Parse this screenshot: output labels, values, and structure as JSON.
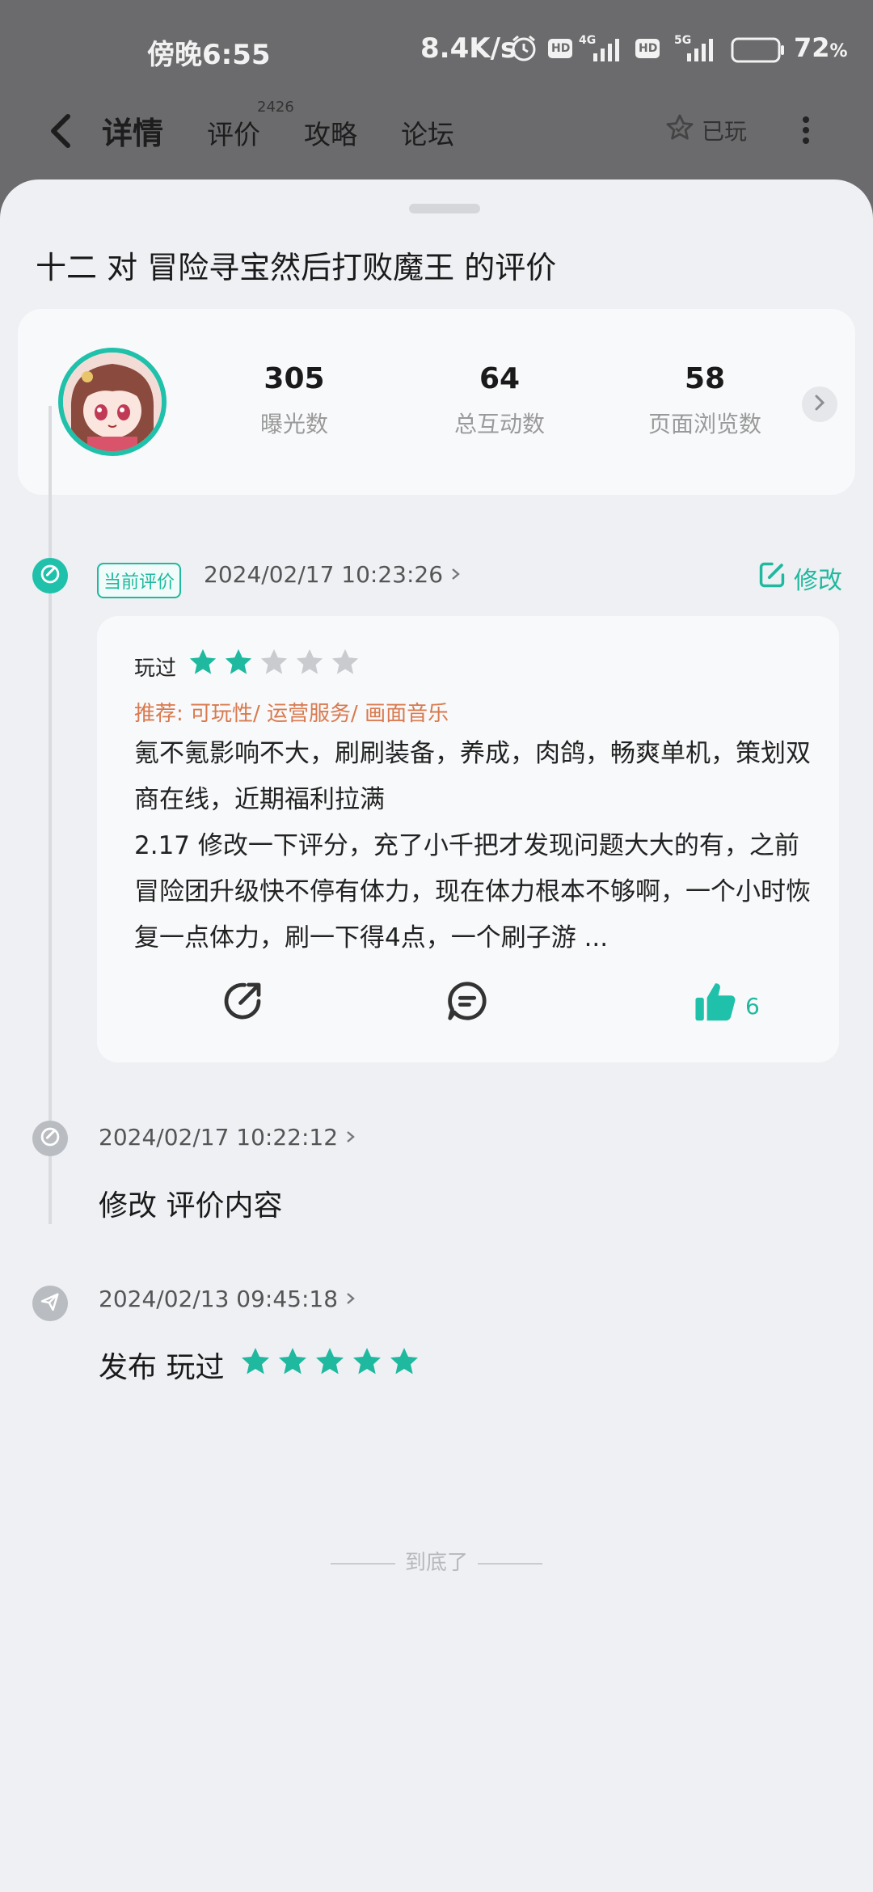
{
  "status_bar": {
    "time": "傍晚6:55",
    "net_speed": "8.4K/s",
    "battery": "72",
    "hd1": "HD",
    "net1": "4G",
    "hd2": "HD",
    "net2": "5G"
  },
  "header": {
    "tabs": [
      {
        "label": "详情"
      },
      {
        "label": "评价"
      },
      {
        "label": "攻略"
      },
      {
        "label": "论坛"
      }
    ],
    "review_count_badge": "2426",
    "played_label": "已玩"
  },
  "sheet": {
    "title": "十二 对 冒险寻宝然后打败魔王 的评价",
    "stats": [
      {
        "value": "305",
        "label": "曝光数"
      },
      {
        "value": "64",
        "label": "总互动数"
      },
      {
        "value": "58",
        "label": "页面浏览数"
      }
    ]
  },
  "timeline": {
    "current": {
      "tag": "当前评价",
      "date": "2024/02/17 10:23:26",
      "edit_label": "修改",
      "played": "玩过",
      "rating": 2,
      "max_rating": 5,
      "recommend": "推荐: 可玩性/ 运营服务/ 画面音乐",
      "body": "氪不氪影响不大，刷刷装备，养成，肉鸽，畅爽单机，策划双商在线，近期福利拉满\n2.17 修改一下评分，充了小千把才发现问题大大的有，之前冒险团升级快不停有体力，现在体力根本不够啊，一个小时恢复一点体力，刷一下得4点，一个刷子游 ...",
      "likes": "6"
    },
    "edit_entry": {
      "date": "2024/02/17 10:22:12",
      "text": "修改 评价内容"
    },
    "publish_entry": {
      "date": "2024/02/13 09:45:18",
      "text": "发布 玩过",
      "rating": 5
    }
  },
  "footer": {
    "end_text": "到底了"
  },
  "colors": {
    "accent": "#1fb99f",
    "star_off": "#c9cbcf",
    "recommend": "#d9794e"
  }
}
